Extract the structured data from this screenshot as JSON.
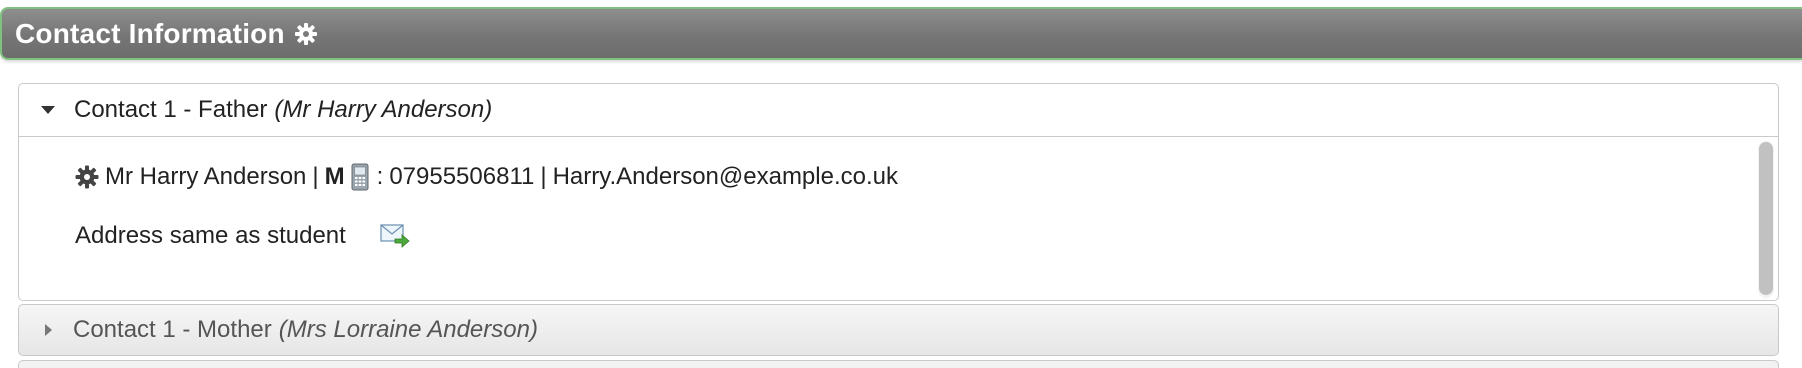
{
  "section": {
    "title": "Contact Information",
    "icon": "gear-icon"
  },
  "contacts": [
    {
      "label": "Contact 1 - Father",
      "name_paren": "(Mr Harry Anderson)",
      "expanded": true,
      "details": {
        "name": "Mr Harry Anderson",
        "separator1": "|",
        "gender": "M",
        "phone_prefix": ":",
        "phone": "07955506811",
        "separator2": "|",
        "email": "Harry.Anderson@example.co.uk",
        "address_note": "Address same as student"
      }
    },
    {
      "label": "Contact 1 - Mother",
      "name_paren": "(Mrs Lorraine Anderson)",
      "expanded": false
    }
  ],
  "colors": {
    "header_bg": "#767676",
    "header_border": "#7fc27f",
    "header_text": "#ffffff",
    "panel_border": "#c9c9c9"
  }
}
